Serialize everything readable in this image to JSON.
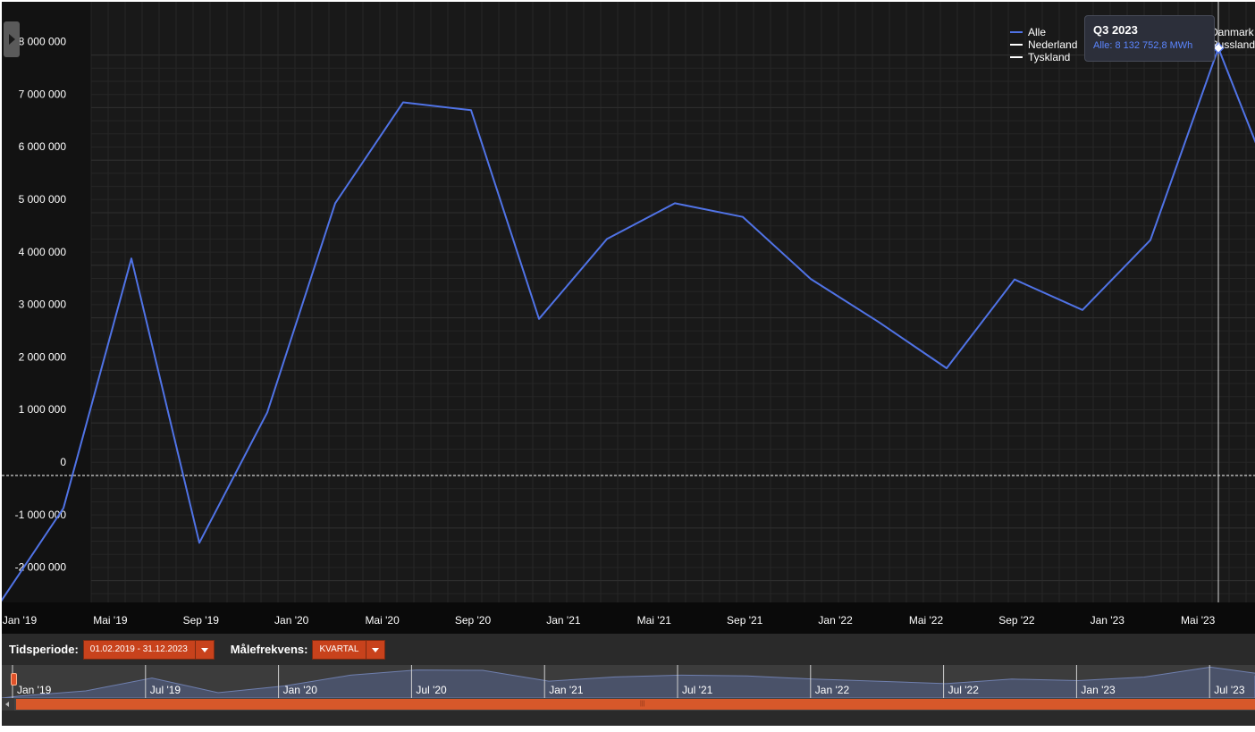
{
  "chart_data": {
    "type": "line",
    "x": [
      "Q1 2019",
      "Q2 2019",
      "Q3 2019",
      "Q4 2019",
      "Q1 2020",
      "Q2 2020",
      "Q3 2020",
      "Q4 2020",
      "Q1 2021",
      "Q2 2021",
      "Q3 2021",
      "Q4 2021",
      "Q1 2022",
      "Q2 2022",
      "Q3 2022",
      "Q4 2022",
      "Q1 2023",
      "Q2 2023",
      "Q3 2023",
      "Q4 2023"
    ],
    "series": [
      {
        "name": "Alle",
        "color": "#5073e6",
        "values": [
          -2550000,
          -620000,
          4130000,
          -1280000,
          1200000,
          5180000,
          7100000,
          6950000,
          2980000,
          4500000,
          5180000,
          4920000,
          3740000,
          2920000,
          2040000,
          3730000,
          3150000,
          4480000,
          8132752.8,
          4860000
        ]
      }
    ],
    "ylim": [
      -2600000,
      8600000
    ],
    "yticks": [
      -2000000,
      -1000000,
      0,
      1000000,
      2000000,
      3000000,
      4000000,
      5000000,
      6000000,
      7000000,
      8000000
    ],
    "ytick_labels": [
      "-2 000 000",
      "-1 000 000",
      "0",
      "1 000 000",
      "2 000 000",
      "3 000 000",
      "4 000 000",
      "5 000 000",
      "6 000 000",
      "7 000 000",
      "8 000 000"
    ],
    "xtick_labels": [
      "Jan '19",
      "Mai '19",
      "Sep '19",
      "Jan '20",
      "Mai '20",
      "Sep '20",
      "Jan '21",
      "Mai '21",
      "Sep '21",
      "Jan '22",
      "Mai '22",
      "Sep '22",
      "Jan '23",
      "Mai '23",
      "S"
    ],
    "grid": true,
    "zero_line": "dashed",
    "legend_position": "top-right"
  },
  "legend": [
    {
      "name": "Alle",
      "color": "#5073e6"
    },
    {
      "name": "Nederland",
      "color": "#ffffff"
    },
    {
      "name": "Tyskland",
      "color": "#ffffff"
    }
  ],
  "legend_right": [
    "Danmark",
    "Russland"
  ],
  "tooltip": {
    "title": "Q3 2023",
    "value": "Alle: 8 132 752,8 MWh"
  },
  "controls": {
    "period_label": "Tidsperiode:",
    "period_value": "01.02.2019 - 31.12.2023",
    "frequency_label": "Målefrekvens:",
    "frequency_value": "KVARTAL"
  },
  "navigator": {
    "labels": [
      "Jan '19",
      "Jul '19",
      "Jan '20",
      "Jul '20",
      "Jan '21",
      "Jul '21",
      "Jan '22",
      "Jul '22",
      "Jan '23",
      "Jul '23"
    ]
  },
  "colors": {
    "background": "#121212",
    "series": "#5073e6",
    "accent": "#c8421c"
  }
}
